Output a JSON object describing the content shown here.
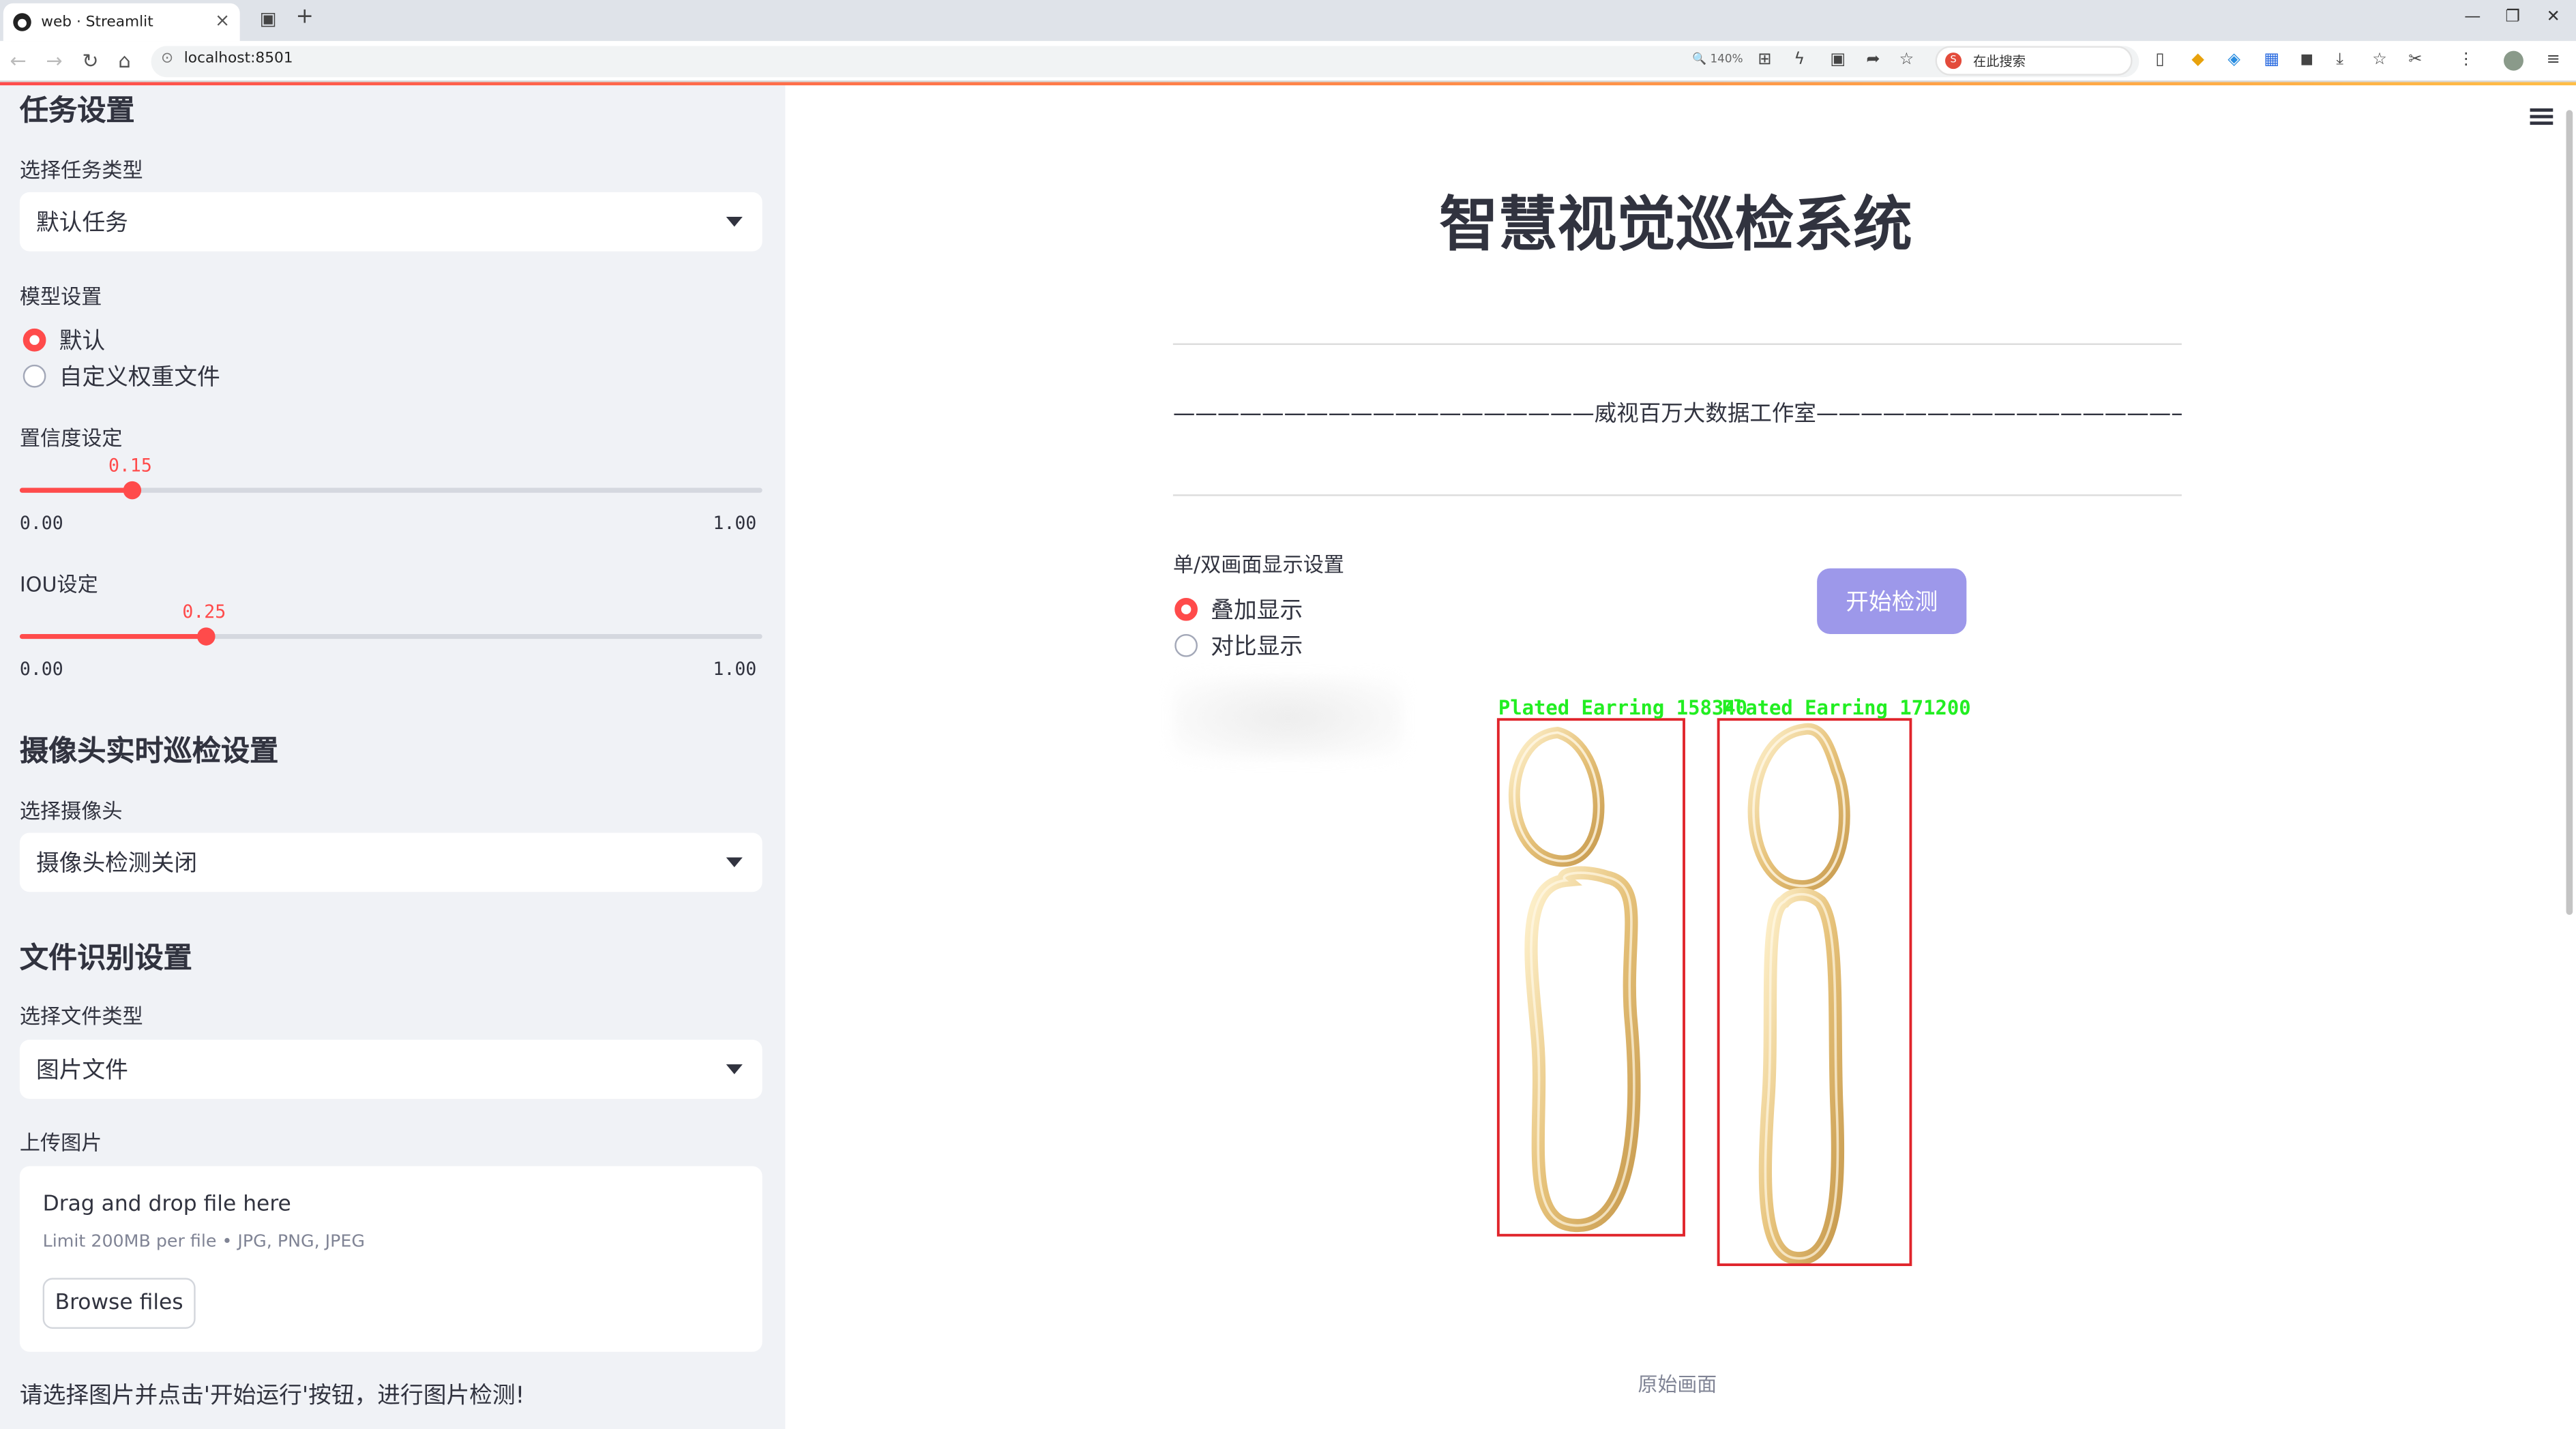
{
  "browser": {
    "tab_title": "web · Streamlit",
    "url": "localhost:8501",
    "zoom": "140%",
    "search_placeholder": "在此搜索"
  },
  "sidebar": {
    "task_section": "任务设置",
    "task_type_label": "选择任务类型",
    "task_type_value": "默认任务",
    "model_label": "模型设置",
    "model_options": [
      "默认",
      "自定义权重文件"
    ],
    "model_selected": 0,
    "conf_label": "置信度设定",
    "conf": {
      "value": "0.15",
      "min": "0.00",
      "max": "1.00",
      "fraction": 0.15
    },
    "iou_label": "IOU设定",
    "iou": {
      "value": "0.25",
      "min": "0.00",
      "max": "1.00",
      "fraction": 0.25
    },
    "camera_section": "摄像头实时巡检设置",
    "camera_label": "选择摄像头",
    "camera_value": "摄像头检测关闭",
    "file_section": "文件识别设置",
    "file_type_label": "选择文件类型",
    "file_type_value": "图片文件",
    "upload_label": "上传图片",
    "drag_text": "Drag and drop file here",
    "limit_text": "Limit 200MB per file • JPG, PNG, JPEG",
    "browse_label": "Browse files",
    "hint": "请选择图片并点击'开始运行'按钮，进行图片检测!"
  },
  "main": {
    "title": "智慧视觉巡检系统",
    "studio": "———————————————————威视百万大数据工作室———————————————————",
    "display_label": "单/双画面显示设置",
    "display_options": [
      "叠加显示",
      "对比显示"
    ],
    "display_selected": 0,
    "start_button": "开始检测",
    "detections": [
      {
        "label": "Plated Earring",
        "score": "158340"
      },
      {
        "label": "Plated Earring",
        "score": "171200"
      }
    ],
    "caption": "原始画面"
  },
  "colors": {
    "accent": "#ff4b4b",
    "button": "#9d98ea",
    "box": "#e0242b",
    "box_text": "#22ee22",
    "gold": "#e8c98a"
  }
}
